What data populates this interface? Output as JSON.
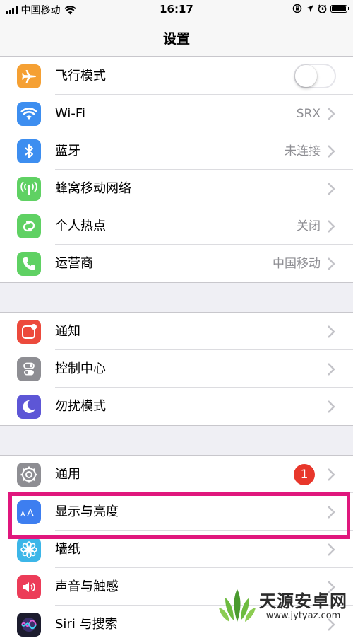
{
  "status_bar": {
    "carrier": "中国移动",
    "time": "16:17",
    "signal_bars": 4
  },
  "nav": {
    "title": "设置"
  },
  "groups": [
    {
      "rows": [
        {
          "label": "飞行模式",
          "icon": "airplane-icon",
          "icon_color": "#f5a033",
          "accessory": "toggle",
          "toggle_on": false
        },
        {
          "label": "Wi-Fi",
          "icon": "wifi-icon",
          "icon_color": "#3d8ef0",
          "value": "SRX",
          "accessory": "chevron"
        },
        {
          "label": "蓝牙",
          "icon": "bluetooth-icon",
          "icon_color": "#3d8ef0",
          "value": "未连接",
          "accessory": "chevron"
        },
        {
          "label": "蜂窝移动网络",
          "icon": "cellular-antenna-icon",
          "icon_color": "#5fd163",
          "accessory": "chevron"
        },
        {
          "label": "个人热点",
          "icon": "hotspot-chain-icon",
          "icon_color": "#5fd163",
          "value": "关闭",
          "accessory": "chevron"
        },
        {
          "label": "运营商",
          "icon": "phone-icon",
          "icon_color": "#5fd163",
          "value": "中国移动",
          "accessory": "chevron"
        }
      ]
    },
    {
      "rows": [
        {
          "label": "通知",
          "icon": "notifications-icon",
          "icon_color": "#ec4a3c",
          "accessory": "chevron"
        },
        {
          "label": "控制中心",
          "icon": "control-center-icon",
          "icon_color": "#8e8e93",
          "accessory": "chevron"
        },
        {
          "label": "勿扰模式",
          "icon": "moon-icon",
          "icon_color": "#5d56d6",
          "accessory": "chevron"
        }
      ]
    },
    {
      "rows": [
        {
          "label": "通用",
          "icon": "gear-icon",
          "icon_color": "#8e8e93",
          "badge": "1",
          "accessory": "chevron"
        },
        {
          "label": "显示与亮度",
          "icon": "display-brightness-icon",
          "icon_color": "#3d7ef0",
          "accessory": "chevron"
        },
        {
          "label": "墙纸",
          "icon": "wallpaper-flower-icon",
          "icon_color": "#3cb6e8",
          "accessory": "chevron"
        },
        {
          "label": "声音与触感",
          "icon": "speaker-icon",
          "icon_color": "#ec3c58",
          "accessory": "chevron"
        },
        {
          "label": "Siri 与搜索",
          "icon": "siri-icon",
          "icon_color": "#1c1c2e",
          "accessory": "chevron"
        }
      ]
    }
  ],
  "watermark": {
    "title": "天源安卓网",
    "url": "www.jytyaz.com",
    "accent": "#4a9a2e"
  },
  "highlight_color": "#e0177d"
}
